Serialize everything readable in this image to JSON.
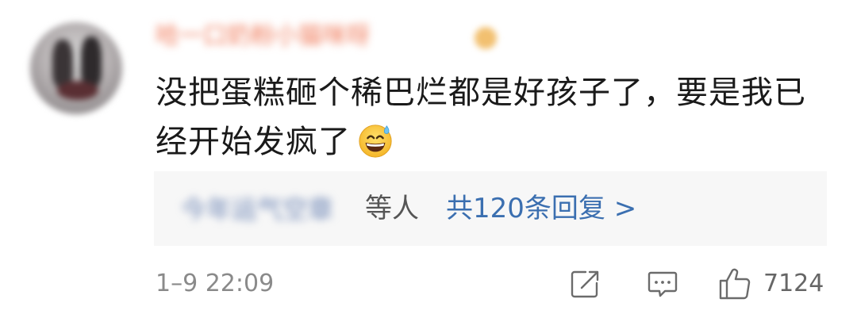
{
  "comment": {
    "username": "哈一口奶粉小猫咪呀",
    "text": "没把蛋糕砸个稀巴烂都是好孩子了，要是我已经开始发疯了",
    "emoji_icon": "grinning-face-with-sweat-icon",
    "replies": {
      "names": "今年运气空章",
      "etc_label": "等人",
      "count_label": "共120条回复 >"
    },
    "time": "1–9 22:09",
    "actions": {
      "share_icon": "share-icon",
      "reply_icon": "comment-icon",
      "like_icon": "thumbs-up-icon",
      "like_count": "7124"
    }
  },
  "colors": {
    "username": "#f07c5c",
    "reply_link": "#3b6fb0",
    "reply_bg": "#f7f7f7",
    "meta": "#8a8a8a"
  }
}
